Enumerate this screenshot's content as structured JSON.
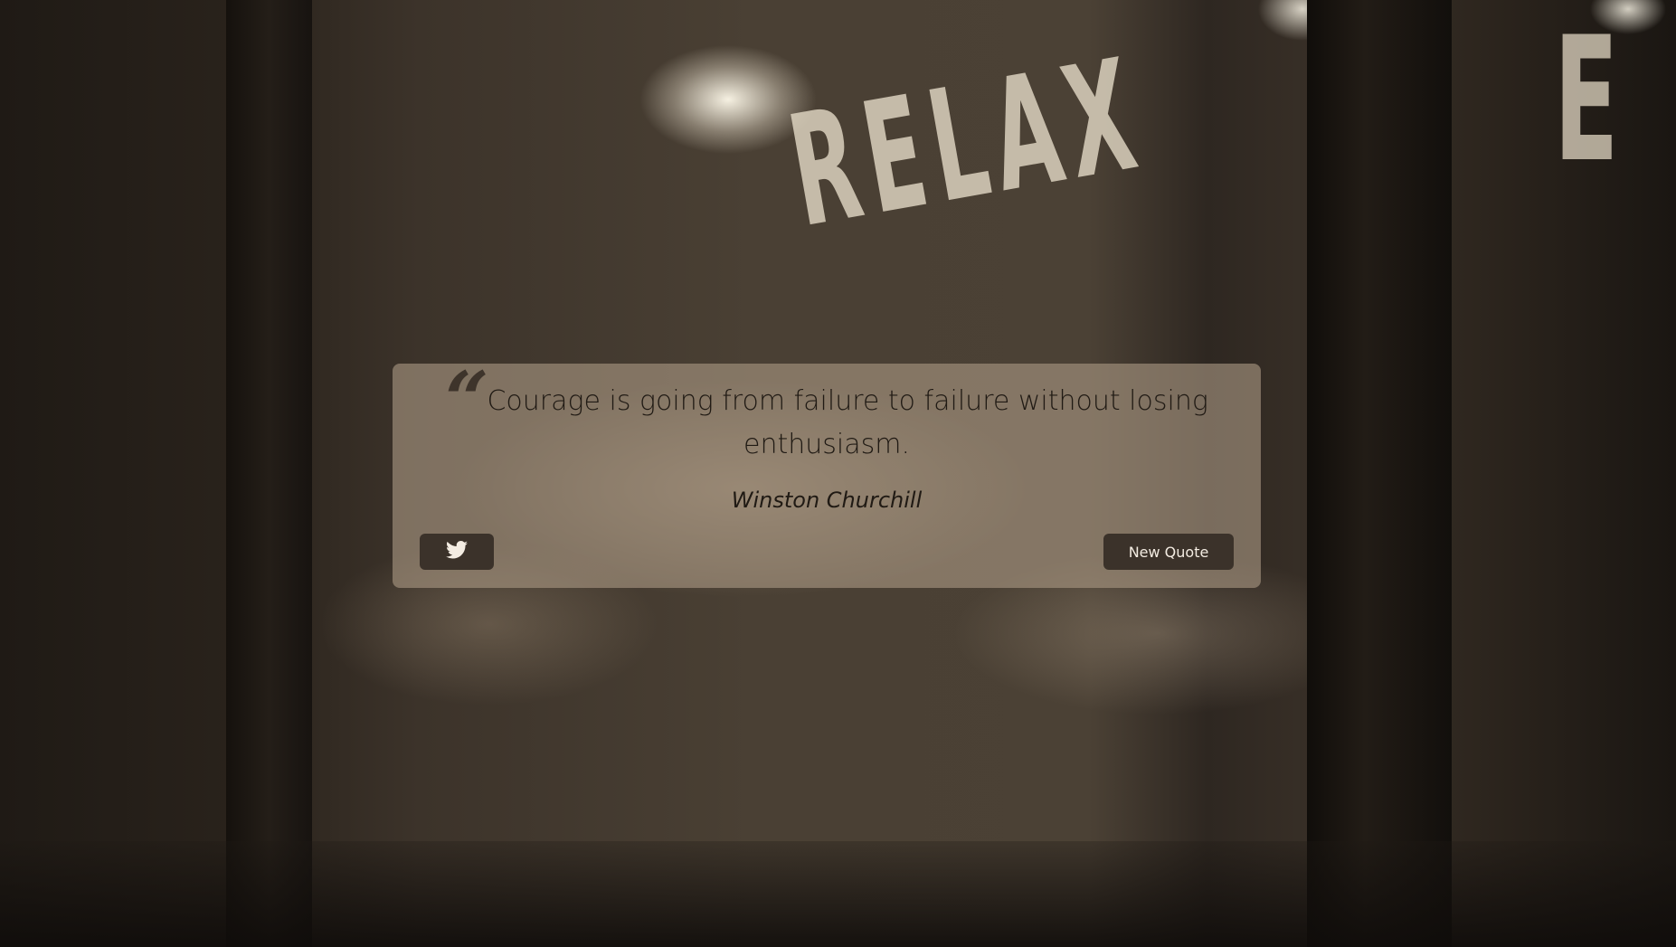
{
  "background": {
    "sign_text": "RELAX",
    "edge_letter": "E"
  },
  "quote": {
    "mark": "“",
    "text": "Courage is going from failure to failure without losing enthusiasm.",
    "author": "Winston Churchill"
  },
  "buttons": {
    "tweet_icon": "twitter-icon",
    "new_quote_label": "New Quote"
  },
  "colors": {
    "card_bg": "#aa9882",
    "button_bg": "#3b322a",
    "button_text": "#f3ece2",
    "text": "#201a14"
  }
}
